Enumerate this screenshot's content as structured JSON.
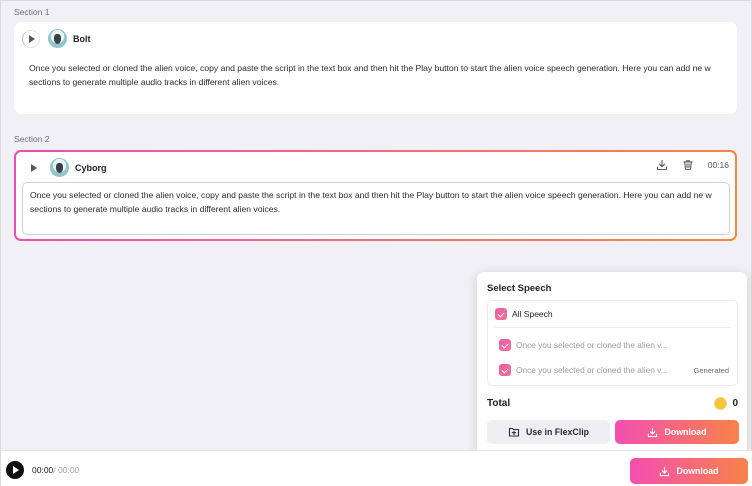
{
  "sections": [
    {
      "label": "Section 1",
      "voice": "Bolt",
      "script": "Once you selected or cloned the alien voice, copy and paste the script in the text box and then hit the Play button to start the alien voice speech generation. Here you can add ne w sections to generate multiple audio tracks in different alien voices."
    },
    {
      "label": "Section 2",
      "voice": "Cyborg",
      "duration": "00:16",
      "script": "Once you selected or cloned the alien voice, copy and paste the script in the text box and then hit the Play button to start the alien voice speech generation. Here you can add ne w sections to generate multiple audio tracks in different alien voices."
    }
  ],
  "popup": {
    "title": "Select Speech",
    "all_label": "All Speech",
    "items": [
      {
        "label": "Once you selected or cloned the alien v...",
        "badge": ""
      },
      {
        "label": "Once you selected or cloned the alien v...",
        "badge": "Generated"
      }
    ],
    "total_label": "Total",
    "total_value": "0",
    "use_button": "Use in FlexClip",
    "download_button": "Download"
  },
  "player": {
    "current": "00:00",
    "total": "/ 00:00",
    "download_button": "Download"
  },
  "colors": {
    "accent_start": "#f34fb2",
    "accent_end": "#f88248",
    "coin": "#f6c33a"
  },
  "icons": [
    "play-icon",
    "download-icon",
    "trash-icon",
    "add-to-flexclip-icon",
    "coin-icon",
    "checkbox-checked-icon"
  ]
}
